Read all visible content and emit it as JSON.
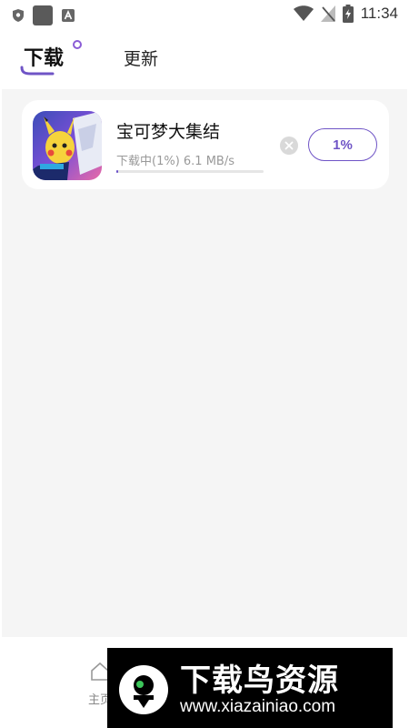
{
  "status_bar": {
    "time": "11:34"
  },
  "tabs": [
    {
      "label": "下载",
      "active": true
    },
    {
      "label": "更新",
      "active": false
    }
  ],
  "download_item": {
    "app_name": "宝可梦大集结",
    "status": "下载中(1%) 6.1 MB/s",
    "progress_percent": 1,
    "button_label": "1%"
  },
  "bottom_nav": {
    "home_label": "主页"
  },
  "watermark": {
    "name": "下载鸟资源",
    "url": "www.xiazainiao.com"
  },
  "colors": {
    "accent": "#6f54c6",
    "background": "#f5f5f5"
  }
}
